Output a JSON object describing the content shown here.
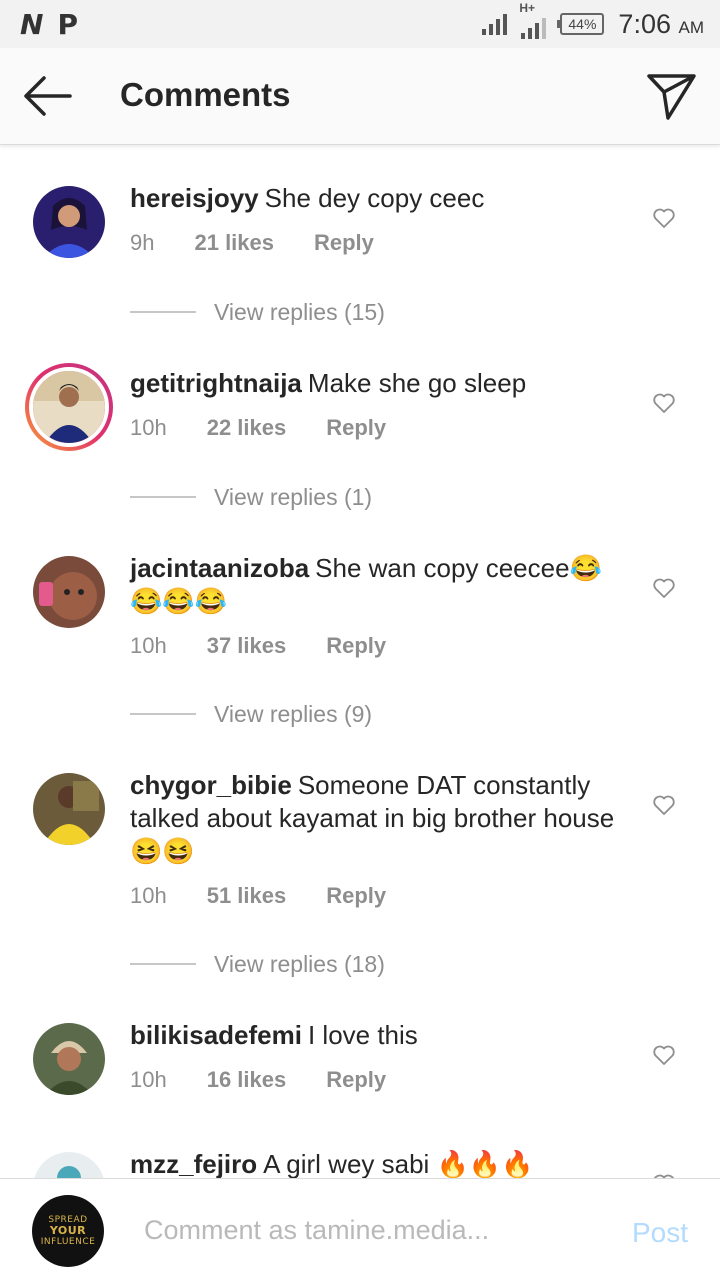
{
  "status_bar": {
    "logos": [
      "N",
      "P"
    ],
    "network_type": "H+",
    "battery": "44%",
    "time": "7:06",
    "ampm": "AM"
  },
  "header": {
    "title": "Comments",
    "back_icon": "arrow-left-icon",
    "share_icon": "paper-plane-icon"
  },
  "comments": [
    {
      "username": "hereisjoyy",
      "text": "She dey copy ceec",
      "time": "9h",
      "likes": "21 likes",
      "reply": "Reply",
      "view_replies": "View replies (15)"
    },
    {
      "username": "getitrightnaija",
      "text": "Make she go sleep",
      "time": "10h",
      "likes": "22 likes",
      "reply": "Reply",
      "view_replies": "View replies (1)"
    },
    {
      "username": "jacintaanizoba",
      "text": "She wan copy ceecee😂😂😂😂",
      "time": "10h",
      "likes": "37 likes",
      "reply": "Reply",
      "view_replies": "View replies (9)"
    },
    {
      "username": "chygor_bibie",
      "text": "Someone DAT constantly talked about kayamat in big brother house 😆😆",
      "time": "10h",
      "likes": "51 likes",
      "reply": "Reply",
      "view_replies": "View replies (18)"
    },
    {
      "username": "bilikisadefemi",
      "text": "I love this",
      "time": "10h",
      "likes": "16 likes",
      "reply": "Reply"
    },
    {
      "username": "mzz_fejiro",
      "text": "A girl wey sabi 🔥🔥🔥"
    }
  ],
  "composer": {
    "placeholder": "Comment as tamine.media...",
    "post_label": "Post",
    "avatar_text": [
      "SPREAD",
      "YOUR",
      "INFLUENCE"
    ]
  },
  "colors": {
    "text": "#262626",
    "muted": "#8e8e8e",
    "post_disabled": "#b3dbff",
    "story_ring": "#e1306c"
  }
}
